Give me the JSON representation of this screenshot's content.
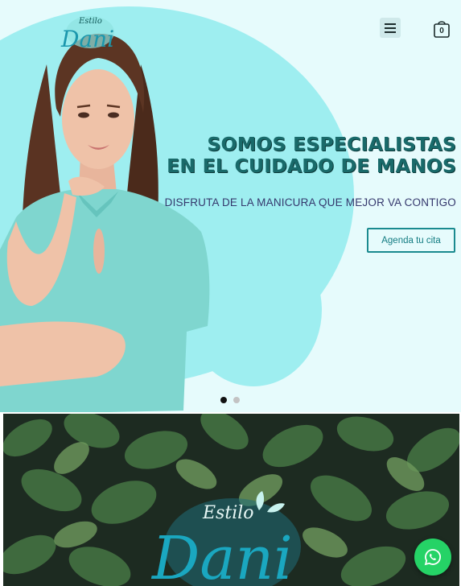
{
  "header": {
    "logo": {
      "script_word": "Estilo",
      "brand_name": "Dani"
    },
    "menu_icon": "hamburger-menu-icon",
    "cart": {
      "icon": "shopping-bag-icon",
      "count": "0"
    }
  },
  "hero": {
    "title_line1": "SOMOS ESPECIALISTAS",
    "title_line2": "EN EL CUIDADO DE MANOS",
    "subtitle": "DISFRUTA DE LA MANICURA QUE MEJOR VA CONTIGO",
    "cta_label": "Agenda tu cita",
    "slides_total": 2,
    "slide_active": 1
  },
  "banner": {
    "logo": {
      "script_word": "Estilo",
      "brand_name": "Dani"
    },
    "background": "green-leaves-photo"
  },
  "floating": {
    "whatsapp_icon": "whatsapp-icon"
  },
  "colors": {
    "hero_bg": "#e6fbfc",
    "blob": "#9eeef0",
    "title": "#196a6a",
    "subtitle": "#35386d",
    "accent": "#1a8a8f",
    "whatsapp": "#25d366"
  }
}
